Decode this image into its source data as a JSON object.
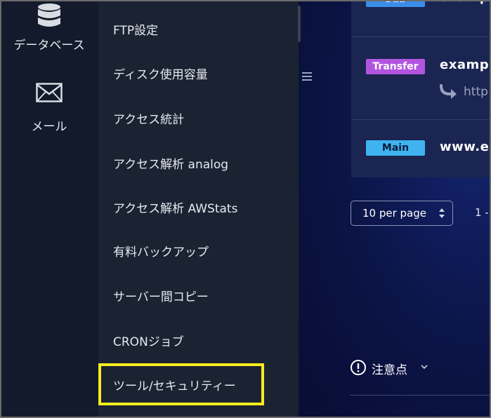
{
  "rail": {
    "items": [
      {
        "label": "データベース",
        "icon": "database-icon"
      },
      {
        "label": "メール",
        "icon": "mail-icon"
      }
    ]
  },
  "submenu": {
    "items": [
      {
        "label": "FTP設定"
      },
      {
        "label": "ディスク使用容量"
      },
      {
        "label": "アクセス統計"
      },
      {
        "label": "アクセス解析 analog"
      },
      {
        "label": "アクセス解析 AWStats"
      },
      {
        "label": "有料バックアップ"
      },
      {
        "label": "サーバー間コピー"
      },
      {
        "label": "CRONジョブ"
      },
      {
        "label": "ツール/セキュリティー"
      }
    ],
    "highlighted_item": "ツール/セキュリティー",
    "highlight_color": "#f5ec1e"
  },
  "domains": {
    "rows": [
      {
        "badge": "Sub",
        "domain": "exampl",
        "badge_color": "#3b8de8"
      },
      {
        "badge": "Transfer",
        "domain": "exampl",
        "redirect": "http",
        "badge_color": "#b254e0"
      },
      {
        "badge": "Main",
        "domain": "www.ex",
        "badge_color": "#3fb3f0"
      }
    ]
  },
  "pagination": {
    "per_page": "10 per page",
    "range": "1 -"
  },
  "notes": {
    "label": "注意点"
  }
}
